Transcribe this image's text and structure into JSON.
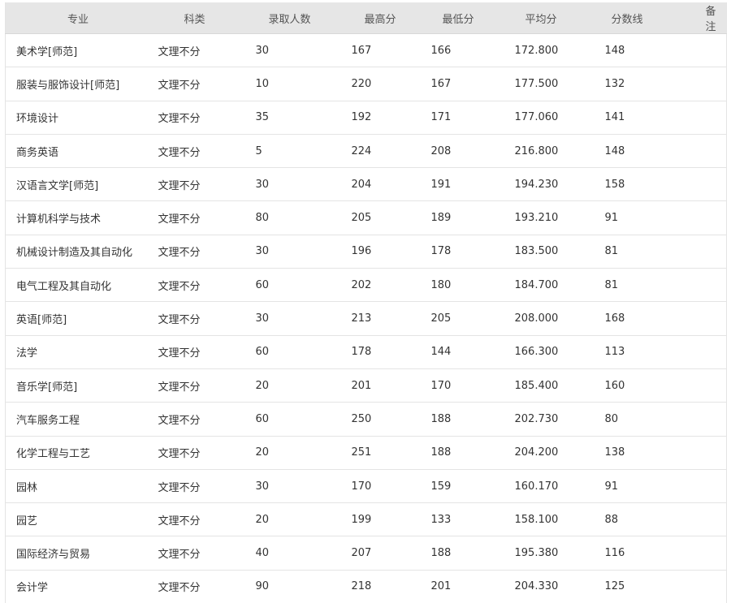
{
  "table": {
    "headers": {
      "major": "专业",
      "category": "科类",
      "admitted": "录取人数",
      "max": "最高分",
      "min": "最低分",
      "avg": "平均分",
      "line": "分数线",
      "note": "备注"
    },
    "rows": [
      {
        "major": "美术学[师范]",
        "category": "文理不分",
        "admitted": "30",
        "max": "167",
        "min": "166",
        "avg": "172.800",
        "line": "148",
        "note": ""
      },
      {
        "major": "服装与服饰设计[师范]",
        "category": "文理不分",
        "admitted": "10",
        "max": "220",
        "min": "167",
        "avg": "177.500",
        "line": "132",
        "note": ""
      },
      {
        "major": "环境设计",
        "category": "文理不分",
        "admitted": "35",
        "max": "192",
        "min": "171",
        "avg": "177.060",
        "line": "141",
        "note": ""
      },
      {
        "major": "商务英语",
        "category": "文理不分",
        "admitted": "5",
        "max": "224",
        "min": "208",
        "avg": "216.800",
        "line": "148",
        "note": ""
      },
      {
        "major": "汉语言文学[师范]",
        "category": "文理不分",
        "admitted": "30",
        "max": "204",
        "min": "191",
        "avg": "194.230",
        "line": "158",
        "note": ""
      },
      {
        "major": "计算机科学与技术",
        "category": "文理不分",
        "admitted": "80",
        "max": "205",
        "min": "189",
        "avg": "193.210",
        "line": "91",
        "note": ""
      },
      {
        "major": "机械设计制造及其自动化",
        "category": "文理不分",
        "admitted": "30",
        "max": "196",
        "min": "178",
        "avg": "183.500",
        "line": "81",
        "note": ""
      },
      {
        "major": "电气工程及其自动化",
        "category": "文理不分",
        "admitted": "60",
        "max": "202",
        "min": "180",
        "avg": "184.700",
        "line": "81",
        "note": ""
      },
      {
        "major": "英语[师范]",
        "category": "文理不分",
        "admitted": "30",
        "max": "213",
        "min": "205",
        "avg": "208.000",
        "line": "168",
        "note": ""
      },
      {
        "major": "法学",
        "category": "文理不分",
        "admitted": "60",
        "max": "178",
        "min": "144",
        "avg": "166.300",
        "line": "113",
        "note": ""
      },
      {
        "major": "音乐学[师范]",
        "category": "文理不分",
        "admitted": "20",
        "max": "201",
        "min": "170",
        "avg": "185.400",
        "line": "160",
        "note": ""
      },
      {
        "major": "汽车服务工程",
        "category": "文理不分",
        "admitted": "60",
        "max": "250",
        "min": "188",
        "avg": "202.730",
        "line": "80",
        "note": ""
      },
      {
        "major": "化学工程与工艺",
        "category": "文理不分",
        "admitted": "20",
        "max": "251",
        "min": "188",
        "avg": "204.200",
        "line": "138",
        "note": ""
      },
      {
        "major": "园林",
        "category": "文理不分",
        "admitted": "30",
        "max": "170",
        "min": "159",
        "avg": "160.170",
        "line": "91",
        "note": ""
      },
      {
        "major": "园艺",
        "category": "文理不分",
        "admitted": "20",
        "max": "199",
        "min": "133",
        "avg": "158.100",
        "line": "88",
        "note": ""
      },
      {
        "major": "国际经济与贸易",
        "category": "文理不分",
        "admitted": "40",
        "max": "207",
        "min": "188",
        "avg": "195.380",
        "line": "116",
        "note": ""
      },
      {
        "major": "会计学",
        "category": "文理不分",
        "admitted": "90",
        "max": "218",
        "min": "201",
        "avg": "204.330",
        "line": "125",
        "note": ""
      }
    ]
  }
}
